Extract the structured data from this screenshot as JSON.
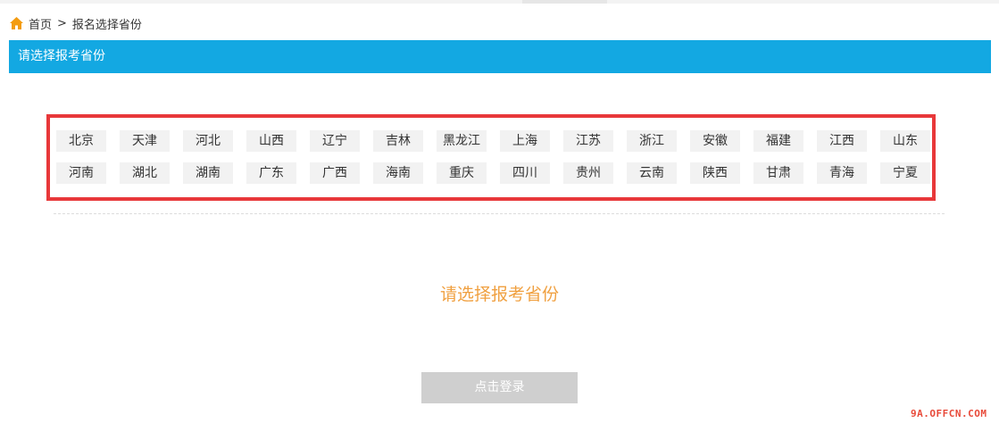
{
  "breadcrumb": {
    "home_label": "首页",
    "separator": ">",
    "current": "报名选择省份"
  },
  "title_bar": {
    "text": "请选择报考省份",
    "color": "#13a8e2"
  },
  "provinces": {
    "row1": [
      "北京",
      "天津",
      "河北",
      "山西",
      "辽宁",
      "吉林",
      "黑龙江",
      "上海",
      "江苏",
      "浙江",
      "安徽",
      "福建",
      "江西",
      "山东"
    ],
    "row2": [
      "河南",
      "湖北",
      "湖南",
      "广东",
      "广西",
      "海南",
      "重庆",
      "四川",
      "贵州",
      "云南",
      "陕西",
      "甘肃",
      "青海",
      "宁夏"
    ],
    "highlight_color": "#e8383a"
  },
  "prompt": {
    "text": "请选择报考省份",
    "color": "#f0a040"
  },
  "login_button": {
    "label": "点击登录"
  },
  "watermark": {
    "text": "9A.OFFCN.COM"
  }
}
